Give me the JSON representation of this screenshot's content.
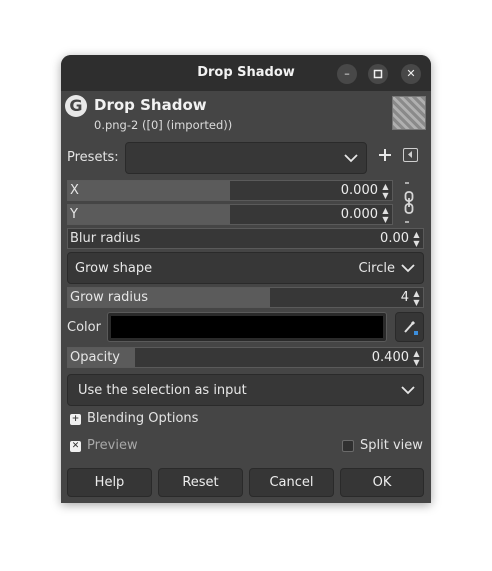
{
  "window": {
    "title": "Drop Shadow"
  },
  "header": {
    "title": "Drop Shadow",
    "subtitle": "0.png-2 ([0] (imported))"
  },
  "presets": {
    "label": "Presets:",
    "value": ""
  },
  "fields": {
    "x": {
      "label": "X",
      "value": "0.000",
      "fill": 0.5
    },
    "y": {
      "label": "Y",
      "value": "0.000",
      "fill": 0.5
    },
    "blur": {
      "label": "Blur radius",
      "value": "0.00",
      "fill": 0.0
    },
    "grow_radius": {
      "label": "Grow radius",
      "value": "4",
      "fill": 0.57
    },
    "opacity": {
      "label": "Opacity",
      "value": "0.400",
      "fill": 0.19
    }
  },
  "grow_shape": {
    "label": "Grow shape",
    "value": "Circle"
  },
  "color": {
    "label": "Color",
    "swatch": "#000000"
  },
  "input_mode": {
    "value": "Use the selection as input"
  },
  "blending": {
    "label": "Blending Options"
  },
  "preview": {
    "label": "Preview",
    "checked": true
  },
  "split_view": {
    "label": "Split view",
    "checked": false
  },
  "buttons": {
    "help": "Help",
    "reset": "Reset",
    "cancel": "Cancel",
    "ok": "OK"
  },
  "colors": {
    "bg": "#454545",
    "titlebar": "#2e2e2e",
    "field": "#373737",
    "fill": "#5b5b5b"
  }
}
